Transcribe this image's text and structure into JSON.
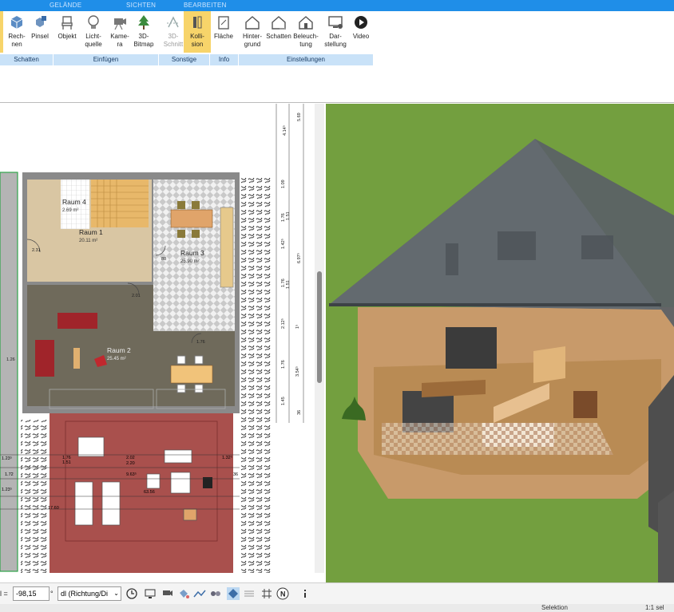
{
  "ribbon_tabs": [
    "GELÄNDE",
    "SICHTEN",
    "BEARBEITEN"
  ],
  "buttons": {
    "rechnen": "Rech-\nnen",
    "pinsel": "Pinsel",
    "objekt": "Objekt",
    "lichtquelle": "Licht-\nquelle",
    "kamera": "Kame-\nra",
    "bitmap3d": "3D-\nBitmap",
    "schnitt3d": "3D-\nSchnitt",
    "kollision": "Kolli-\nsion",
    "flaeche": "Fläche",
    "hintergrund": "Hinter-\ngrund",
    "schatten": "Schatten",
    "beleuchtung": "Beleuch-\ntung",
    "darstellung": "Dar-\nstellung",
    "video": "Video"
  },
  "group_labels": {
    "schatten": "Schatten",
    "einfuegen": "Einfügen",
    "sonstige": "Sonstige",
    "info": "Info",
    "einstellungen": "Einstellungen"
  },
  "floorplan": {
    "rooms": [
      {
        "name": "Raum 4",
        "area": "2.69 m²"
      },
      {
        "name": "Raum 1",
        "area": "20.11 m²"
      },
      {
        "name": "Raum 3",
        "area": "25.90 m²"
      },
      {
        "name": "Raum 2",
        "area": "25.45 m²"
      }
    ],
    "dims_right": [
      "5.69",
      "4.14⁵",
      "1.09",
      "1.51",
      "1.76",
      "6.97⁵",
      "1.42⁵",
      "1.51",
      "1.76",
      "2.12⁵",
      "1⁵",
      "1.76",
      "3.54⁵",
      "1.45",
      "36"
    ],
    "dims_bottom": [
      "1.23⁵",
      "1.76",
      "1.51",
      "2.02",
      "2.20",
      "1.32⁵",
      "1.72",
      "9.63⁵",
      "63.56",
      "17.60",
      "1.23⁵",
      "36",
      "2.20"
    ],
    "dims_small": [
      "2.31",
      "88",
      "2.01",
      "1.76",
      "88",
      "2.01",
      "88",
      "2.01",
      "1.26"
    ]
  },
  "bottom": {
    "prefix": "l =",
    "value": "-98,15",
    "unit": "°",
    "direction": "dl (Richtung/Di"
  },
  "status": {
    "mode": "Selektion",
    "scale": "1:1 sel"
  },
  "colors": {
    "ribbon_blue": "#1f8ee8",
    "group_label_bg": "#c9e2f8",
    "active_button": "#f7d46a",
    "grass": "#6f9a3e",
    "roof": "#5a6066",
    "terrace": "#a9504d"
  }
}
